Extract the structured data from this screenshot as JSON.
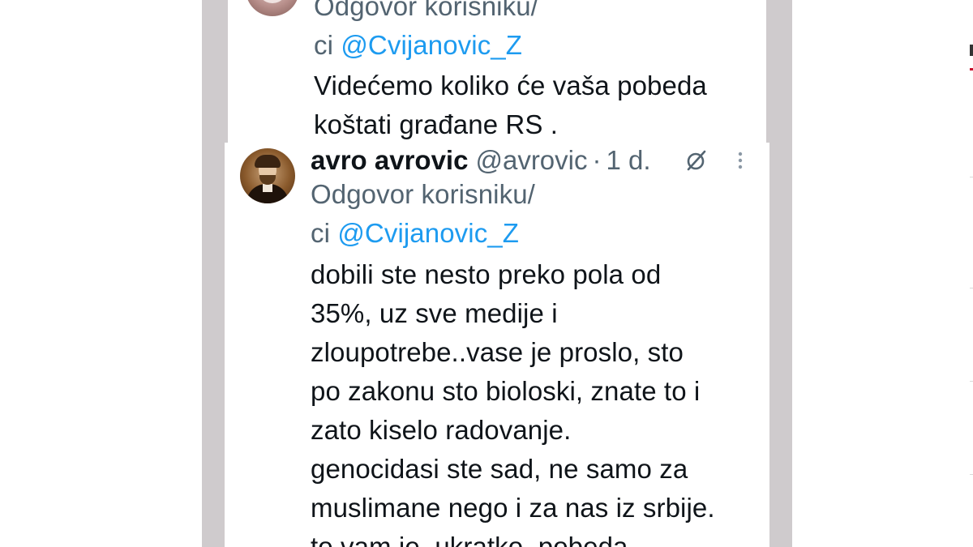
{
  "tweet_top": {
    "replying_line1": "Odgovor korisniku/",
    "replying_line2_prefix": "ci ",
    "mention": "@Cvijanovic_Z",
    "body_lines": [
      "Videćemo koliko će vaša pobeda",
      "koštati građane RS ."
    ]
  },
  "tweet_main": {
    "display_name": "avro avrovic",
    "handle": "@avrovic",
    "separator": "·",
    "time": "1 d.",
    "grok_icon": "grok-slash-icon",
    "more_icon": "more-vertical-icon",
    "replying_line1": "Odgovor korisniku/",
    "replying_line2_prefix": "ci ",
    "mention": "@Cvijanovic_Z",
    "body_lines": [
      "dobili ste nesto preko pola od",
      "35%, uz sve medije i",
      "zloupotrebe..vase je proslo, sto",
      "po zakonu sto bioloski, znate to i",
      "zato kiselo radovanje.",
      "genocidasi ste sad, ne samo za",
      "muslimane nego i za nas iz srbije.",
      "to vam je, ukratko, pobeda"
    ]
  },
  "colors": {
    "text": "#0f1419",
    "secondary": "#536471",
    "link": "#1d9bf0",
    "backdrop": "#cfcbcd"
  }
}
